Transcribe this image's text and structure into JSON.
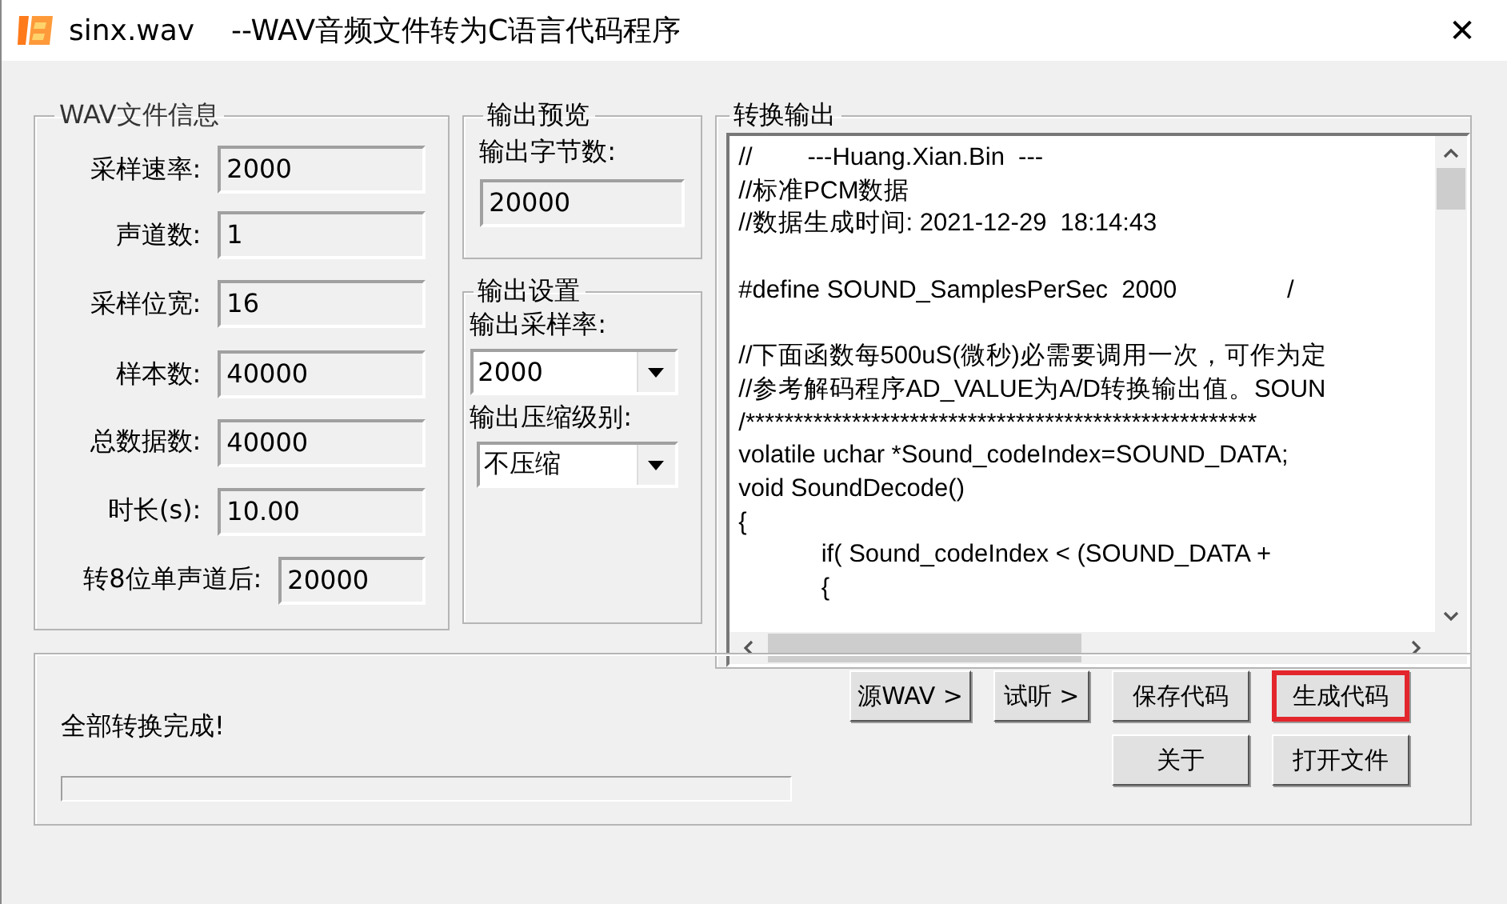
{
  "window": {
    "title": "sinx.wav    --WAV音频文件转为C语言代码程序",
    "close": "✕"
  },
  "wav_info": {
    "title": "WAV文件信息",
    "fields": [
      {
        "label": "采样速率:",
        "value": "2000"
      },
      {
        "label": "声道数:",
        "value": "1"
      },
      {
        "label": "采样位宽:",
        "value": "16"
      },
      {
        "label": "样本数:",
        "value": "40000"
      },
      {
        "label": "总数据数:",
        "value": "40000"
      },
      {
        "label": "时长(s):",
        "value": "10.00"
      },
      {
        "label": "转8位单声道后:",
        "value": "20000"
      }
    ]
  },
  "output_preview": {
    "title": "输出预览",
    "label": "输出字节数:",
    "value": "20000"
  },
  "output_settings": {
    "title": "输出设置",
    "combos": [
      {
        "label": "输出采样率:",
        "value": "2000"
      },
      {
        "label": "输出压缩级别:",
        "value": "不压缩"
      }
    ]
  },
  "conversion_output": {
    "title": "转换输出",
    "blocks": [
      [
        "//        ---Huang.Xian.Bin  ---",
        "//标准PCM数据",
        "//数据生成时间: 2021-12-29  18:14:43"
      ],
      [
        "#define SOUND_SamplesPerSec  2000                /"
      ],
      [
        "//下面函数每500uS(微秒)必需要调用一次，可作为定",
        "//参考解码程序AD_VALUE为A/D转换输出值。SOUN",
        "/*****************************************************",
        "volatile uchar *Sound_codeIndex=SOUND_DATA;",
        "void SoundDecode()",
        "{",
        "            if( Sound_codeIndex < (SOUND_DATA +",
        "            {"
      ]
    ]
  },
  "status": {
    "message": "全部转换完成!"
  },
  "buttons_upper": [
    {
      "label": "源WAV >",
      "highlighted": false
    },
    {
      "label": "试听 >",
      "highlighted": false
    },
    {
      "label": "保存代码",
      "highlighted": false
    },
    {
      "label": "生成代码",
      "highlighted": true
    }
  ],
  "buttons_lower": [
    {
      "label": "关于",
      "highlighted": false
    },
    {
      "label": "打开文件",
      "highlighted": false
    }
  ]
}
